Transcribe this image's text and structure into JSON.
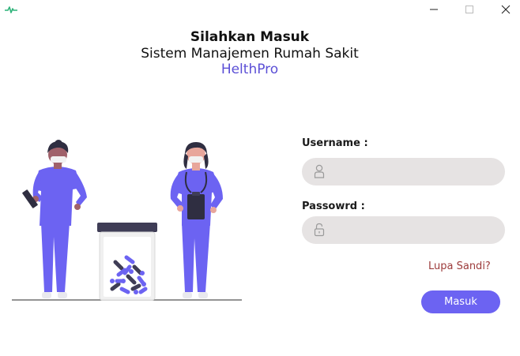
{
  "window": {
    "app_icon": "heartbeat-icon",
    "controls": {
      "minimize_icon": "minimize-icon",
      "maximize_icon": "maximize-icon",
      "close_icon": "close-icon"
    }
  },
  "header": {
    "title": "Silahkan Masuk",
    "subtitle": "Sistem Manajemen Rumah Sakit",
    "brand": "HelthPro"
  },
  "illustration": {
    "description_icon": "medical-staff-illustration",
    "accent_color": "#6c63f2"
  },
  "form": {
    "username_label": "Username :",
    "username_value": "",
    "username_icon": "user-icon",
    "password_label": "Passowrd :",
    "password_value": "",
    "password_icon": "lock-icon",
    "forgot_label": "Lupa Sandi?",
    "submit_label": "Masuk"
  },
  "colors": {
    "accent": "#6c63f2",
    "brand_text": "#5b4fd6",
    "link": "#9c3b3b",
    "field_bg": "#e6e3e3"
  }
}
